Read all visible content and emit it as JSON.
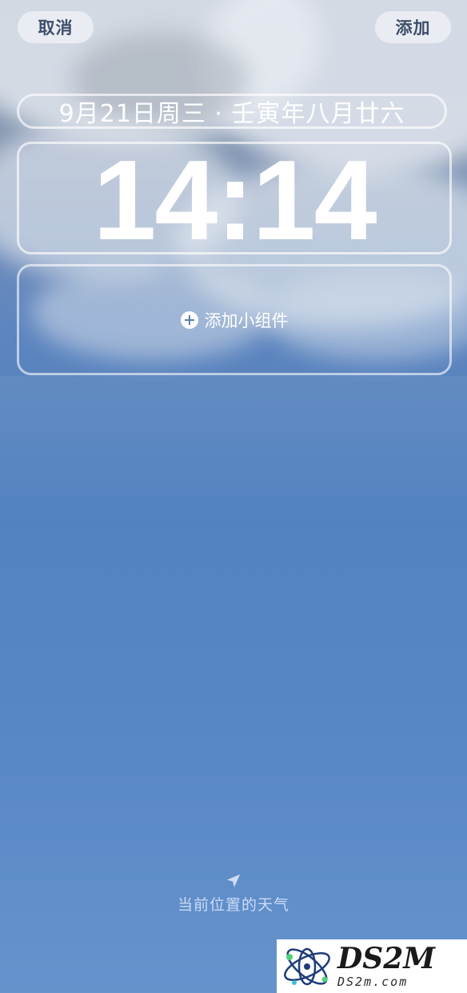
{
  "header": {
    "cancel_label": "取消",
    "add_label": "添加"
  },
  "lockscreen": {
    "date_text": "9月21日周三 · 壬寅年八月廿六",
    "time_text": "14:14",
    "add_widget_label": "添加小组件"
  },
  "weather": {
    "label": "当前位置的天气",
    "icon": "location-arrow-icon"
  },
  "watermark": {
    "brand": "DS2M",
    "domain": "DS2m.com"
  },
  "colors": {
    "sky_blue": "#4c7ebd",
    "button_bg": "#eceff5",
    "button_text": "#3f4f69"
  }
}
